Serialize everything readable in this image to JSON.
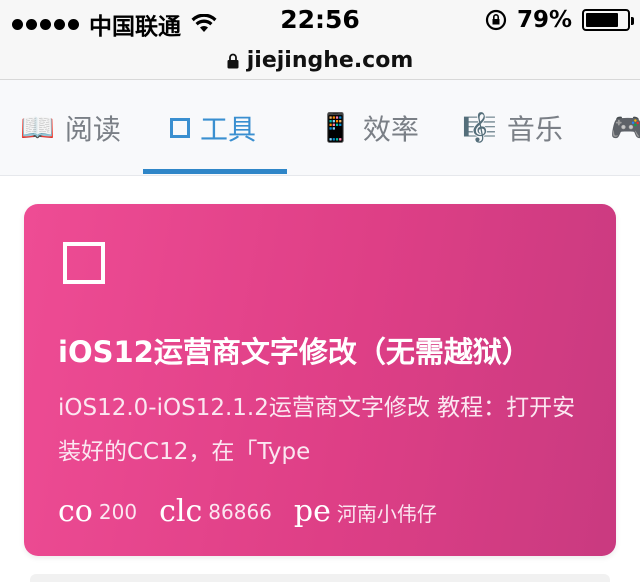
{
  "status_bar": {
    "carrier": "中国联通",
    "time": "22:56",
    "battery_percent_text": "79%",
    "battery_level": 0.79
  },
  "url_bar": {
    "url": "jiejinghe.com"
  },
  "tabs": [
    {
      "label": "阅读",
      "icon": "book-icon",
      "glyph": "📖",
      "active": false
    },
    {
      "label": "工具",
      "icon": "square-icon",
      "glyph": "☐",
      "active": true
    },
    {
      "label": "效率",
      "icon": "phone-icon",
      "glyph": "📱",
      "active": false
    },
    {
      "label": "音乐",
      "icon": "music-score-icon",
      "glyph": "🎼",
      "active": false
    },
    {
      "label": "",
      "icon": "gamepad-icon",
      "glyph": "🎮",
      "active": false
    }
  ],
  "card": {
    "title": "iOS12运营商文字修改（无需越狱）",
    "description": "iOS12.0-iOS12.1.2运营商文字修改 教程：打开安装好的CC12，在「Type",
    "meta": {
      "comments_icon_text": "co",
      "comments_count": "200",
      "clicks_icon_text": "clc",
      "clicks_count": "86866",
      "author_icon_text": "pe",
      "author": "河南小伟仔"
    },
    "colors": {
      "gradient_start": "#ee4c94",
      "gradient_end": "#c93a80"
    }
  },
  "theme": {
    "active_tab_color": "#3a8fd0",
    "inactive_tab_color": "#7a7f86"
  }
}
